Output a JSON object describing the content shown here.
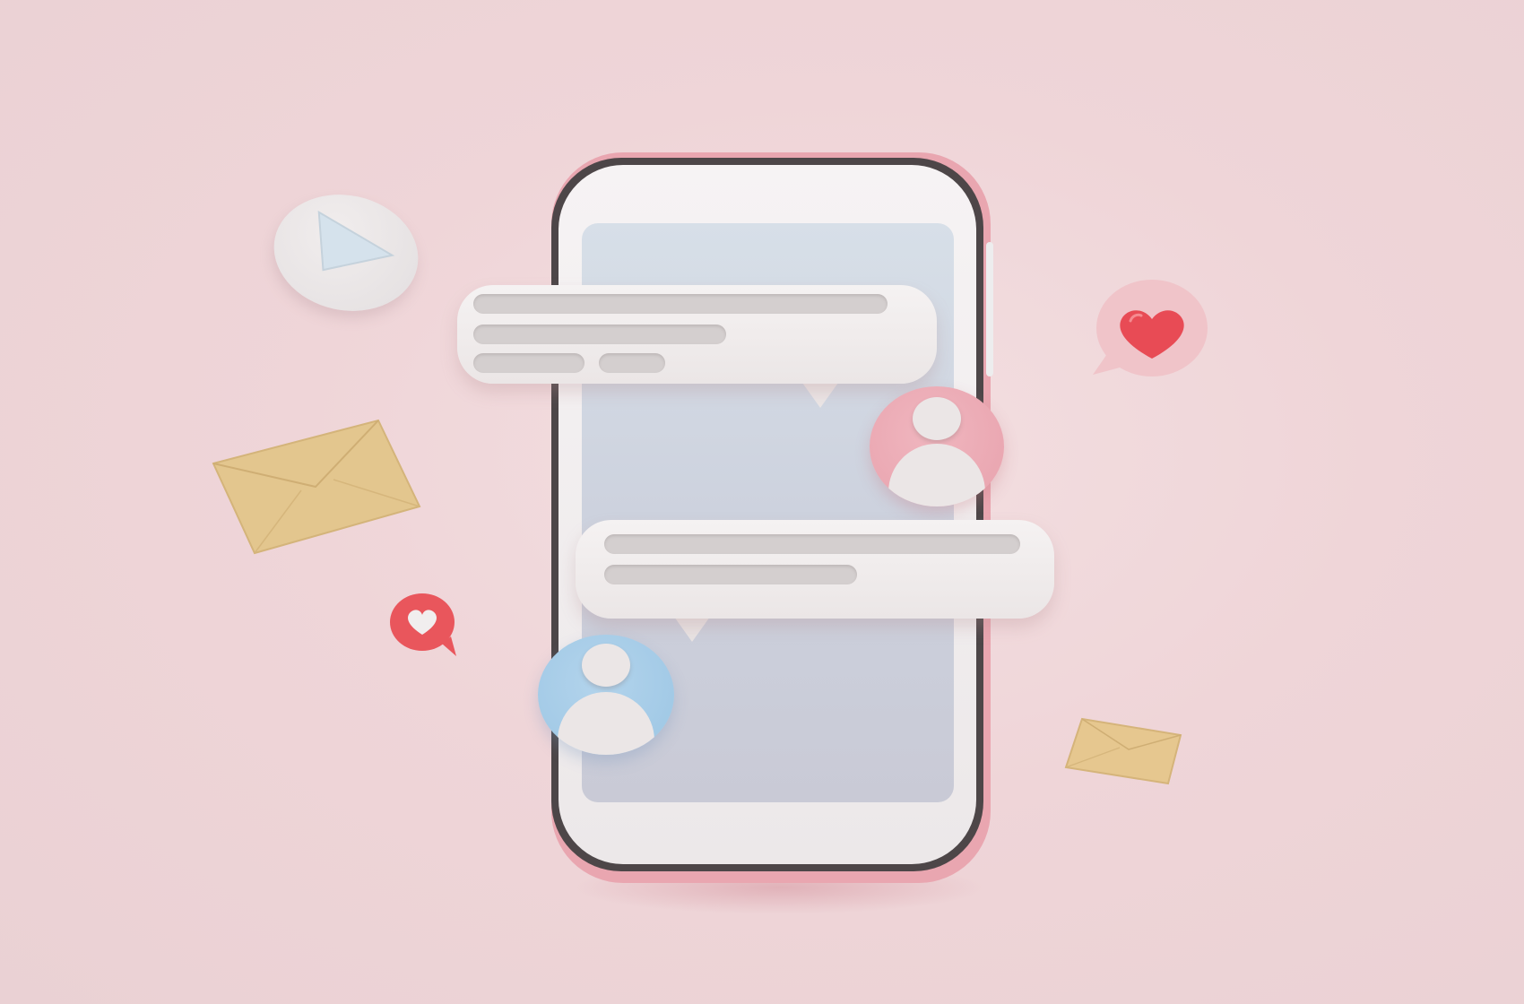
{
  "scene": {
    "background_color": "#efd5d8",
    "phone": {
      "frame_color": "#4d4648",
      "body_color": "#f2eff0",
      "screen_color": "#cdd2de",
      "back_color": "#e9a6b0"
    },
    "messages": [
      {
        "sender": "pink-avatar",
        "lines": 3
      },
      {
        "sender": "blue-avatar",
        "lines": 2
      }
    ],
    "avatars": [
      {
        "name": "pink",
        "color": "#e8a2ad"
      },
      {
        "name": "blue",
        "color": "#9cc6e4"
      }
    ],
    "icons": [
      "play-icon",
      "envelope-icon",
      "heart-icon",
      "heart-icon",
      "envelope-icon"
    ],
    "accent_colors": {
      "heart_red": "#e84b55",
      "envelope_gold": "#e3c68e",
      "play_blue": "#d5e2ec"
    }
  }
}
